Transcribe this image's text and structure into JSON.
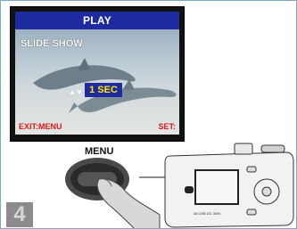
{
  "screen": {
    "title": "PLAY",
    "mode_label": "SLIDE SHOW",
    "value": "1 SEC",
    "exit_hint": "EXIT:MENU",
    "set_hint": "SET:",
    "arrow_glyph": "▲▼"
  },
  "menu_button_label": "MENU",
  "step_number": "4",
  "camera_label": "48 USB DC 30IN",
  "colors": {
    "title_bar": "#1e2aa0",
    "value_text": "#ffe800",
    "hint_text": "#e01818",
    "badge": "#8c8c8c"
  }
}
